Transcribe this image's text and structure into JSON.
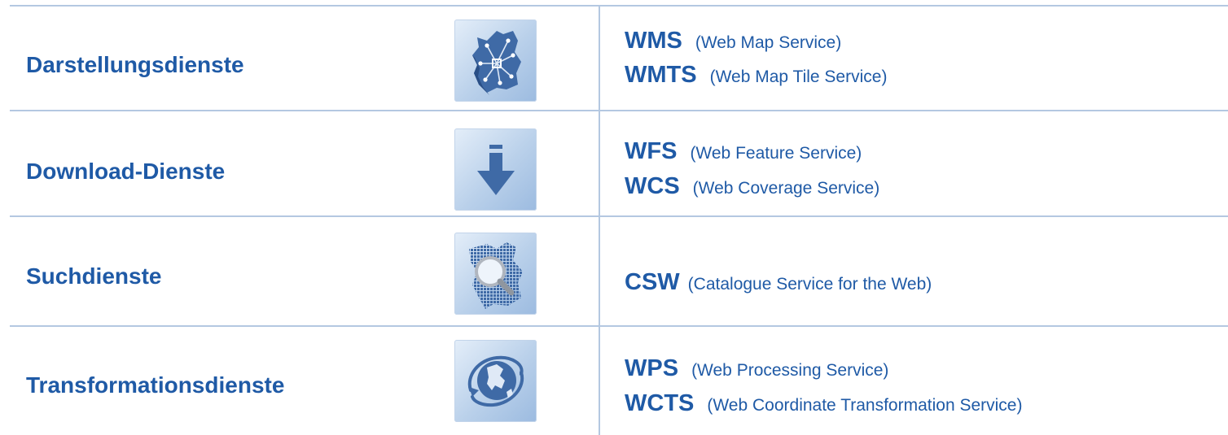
{
  "rows": [
    {
      "category": "Darstellungsdienste",
      "icon": "map-network-icon",
      "services": [
        {
          "abbr": "WMS",
          "full": "(Web Map Service)"
        },
        {
          "abbr": "WMTS",
          "full": "(Web Map Tile Service)"
        }
      ]
    },
    {
      "category": "Download-Dienste",
      "icon": "download-arrow-icon",
      "services": [
        {
          "abbr": "WFS",
          "full": "(Web Feature Service)"
        },
        {
          "abbr": "WCS",
          "full": "(Web Coverage Service)"
        }
      ]
    },
    {
      "category": "Suchdienste",
      "icon": "search-map-icon",
      "services": [
        {
          "abbr": "CSW",
          "full": "(Catalogue Service for the Web)"
        }
      ]
    },
    {
      "category": "Transformationsdienste",
      "icon": "globe-transform-icon",
      "services": [
        {
          "abbr": "WPS",
          "full": "(Web Processing Service)"
        },
        {
          "abbr": "WCTS",
          "full": "(Web Coordinate Transformation Service)"
        }
      ]
    }
  ],
  "colors": {
    "text": "#1f5aa6",
    "lines": "#b4c8e1",
    "icon": "#3f6aa6"
  }
}
